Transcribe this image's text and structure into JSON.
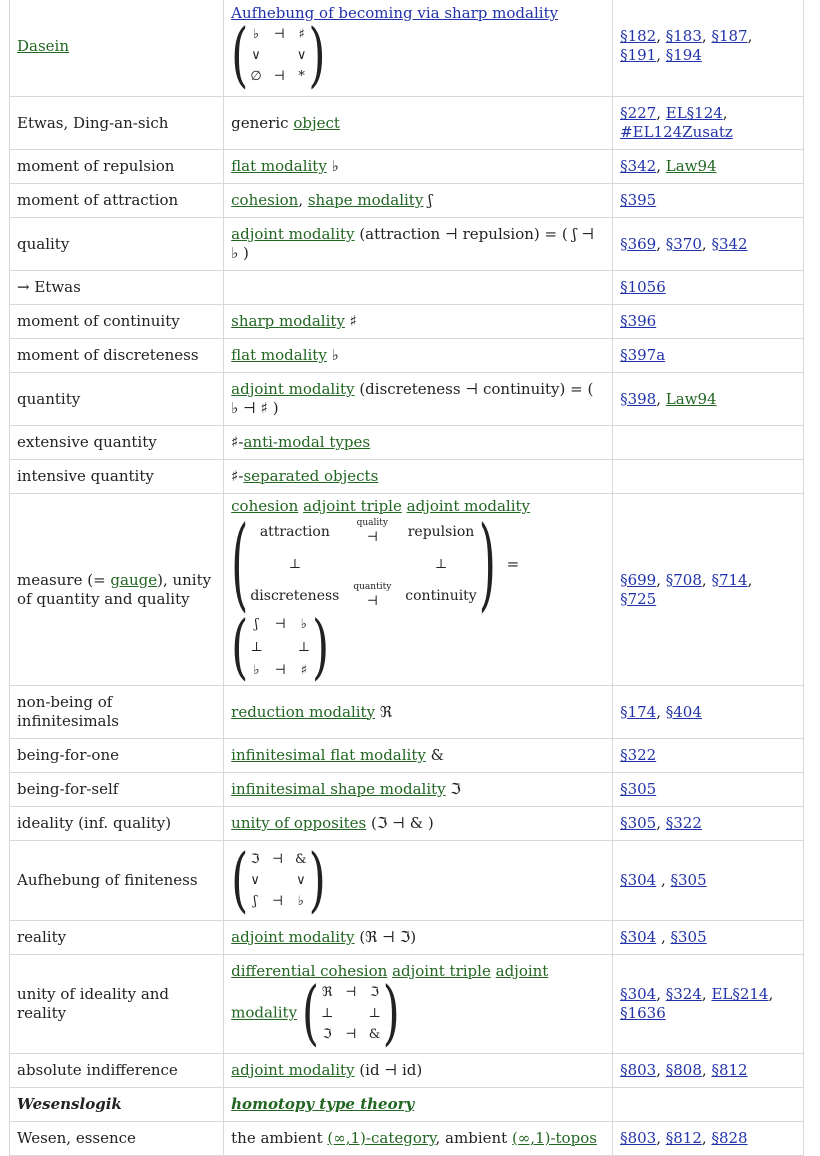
{
  "rows": [
    {
      "c1": "Dasein",
      "c2_link": "Aufhebung of becoming via sharp modality",
      "matrix": [
        "♭",
        "⊣",
        "♯",
        "∨",
        "",
        "∨",
        "∅",
        "⊣",
        "*"
      ],
      "c3": [
        "§182",
        "§183",
        "§187",
        "§191",
        "§194"
      ]
    },
    {
      "c1": "Etwas, Ding-an-sich",
      "c2_text": "generic ",
      "c2_link": "object",
      "c3": [
        "§227",
        "EL§124",
        "#EL124Zusatz"
      ]
    },
    {
      "c1": "moment of repulsion",
      "c2_link": "flat modality",
      "c2_sym": " ♭",
      "c3": [
        "§342",
        "Law94"
      ]
    },
    {
      "c1": "moment of attraction",
      "c2_link1": "cohesion",
      "c2_sep": ", ",
      "c2_link2": "shape modality",
      "c2_sym": " ʃ",
      "c3": [
        "§395"
      ]
    },
    {
      "c1": "quality",
      "c2_link": "adjoint modality",
      "c2_rest": " (attraction  ⊣  repulsion) = ( ʃ ⊣ ♭ )",
      "c3": [
        "§369",
        "§370",
        "§342"
      ]
    },
    {
      "c1": "→  Etwas",
      "c3": [
        "§1056"
      ]
    },
    {
      "c1": "moment of continuity",
      "c2_link": "sharp modality",
      "c2_sym": " ♯",
      "c3": [
        "§396"
      ]
    },
    {
      "c1": "moment of discreteness",
      "c2_link": "flat modality",
      "c2_sym": " ♭",
      "c3": [
        "§397a"
      ]
    },
    {
      "c1": "quantity",
      "c2_link": "adjoint modality",
      "c2_rest": " (discreteness  ⊣  continuity) = ( ♭ ⊣ ♯ )",
      "c3": [
        "§398",
        "Law94"
      ]
    },
    {
      "c1": "extensive quantity",
      "c2_pre": "♯-",
      "c2_link": "anti-modal types"
    },
    {
      "c1": "intensive quantity",
      "c2_pre": "♯-",
      "c2_link": "separated objects"
    },
    {
      "c1_a": "measure (= ",
      "c1_link": "gauge",
      "c1_b": "), unity of quantity and quality",
      "c2_link1": "cohesion",
      "c2_link2": "adjoint triple",
      "c2_link3": "adjoint modality",
      "big": {
        "attraction": "attraction",
        "quality": "quality",
        "repulsion": "repulsion",
        "discreteness": "discreteness",
        "quantity": "quantity",
        "continuity": "continuity",
        "adj": "⊣",
        "perp": "⊥"
      },
      "small": [
        "ʃ",
        "⊣",
        "♭",
        "⊥",
        "",
        "⊥",
        "♭",
        "⊣",
        "♯"
      ],
      "eq": "=",
      "c3": [
        "§699",
        "§708",
        "§714",
        "§725"
      ]
    },
    {
      "c1": "non-being of infinitesimals",
      "c2_link": "reduction modality",
      "c2_sym": " ℜ",
      "c3": [
        "§174",
        "§404"
      ]
    },
    {
      "c1": "being-for-one",
      "c2_link": "infinitesimal flat modality",
      "c2_sym": " &",
      "c3": [
        "§322"
      ]
    },
    {
      "c1": "being-for-self",
      "c2_link": "infinitesimal shape modality",
      "c2_sym": " ℑ",
      "c3": [
        "§305"
      ]
    },
    {
      "c1": "ideality (inf. quality)",
      "c2_link": "unity of opposites",
      "c2_rest": " (ℑ ⊣ & )",
      "c3": [
        "§305",
        "§322"
      ]
    },
    {
      "c1": "Aufhebung of finiteness",
      "matrix": [
        "ℑ",
        "⊣",
        "&",
        "∨",
        "",
        "∨",
        "ʃ",
        "⊣",
        "♭"
      ],
      "c3": [
        "§304",
        "§305"
      ],
      "c3_sep": " , "
    },
    {
      "c1": "reality",
      "c2_link": "adjoint modality",
      "c2_rest": " (ℜ ⊣ ℑ)",
      "c3": [
        "§304",
        "§305"
      ],
      "c3_sep": " , "
    },
    {
      "c1": "unity of ideality and reality",
      "c2_link1": "differential cohesion",
      "c2_link2": "adjoint triple",
      "c2_link3": "adjoint",
      "c2_link4": "modality",
      "matrix": [
        "ℜ",
        "⊣",
        "ℑ",
        "⊥",
        "",
        "⊥",
        "ℑ",
        "⊣",
        "&"
      ],
      "c3": [
        "§304",
        "§324",
        "EL§214",
        "§1636"
      ]
    },
    {
      "c1": "absolute indifference",
      "c2_link": "adjoint modality",
      "c2_rest": " (id ⊣ id)",
      "c3": [
        "§803",
        "§808",
        "§812"
      ]
    },
    {
      "c1": "Wesenslogik",
      "c2_link": "homotopy type theory"
    },
    {
      "c1": "Wesen, essence",
      "c2_text": "the ambient ",
      "c2_link1": "(∞,1)-category",
      "c2_sep": ", ambient ",
      "c2_link2": "(∞,1)-topos",
      "c3": [
        "§803",
        "§812",
        "§828"
      ]
    }
  ]
}
